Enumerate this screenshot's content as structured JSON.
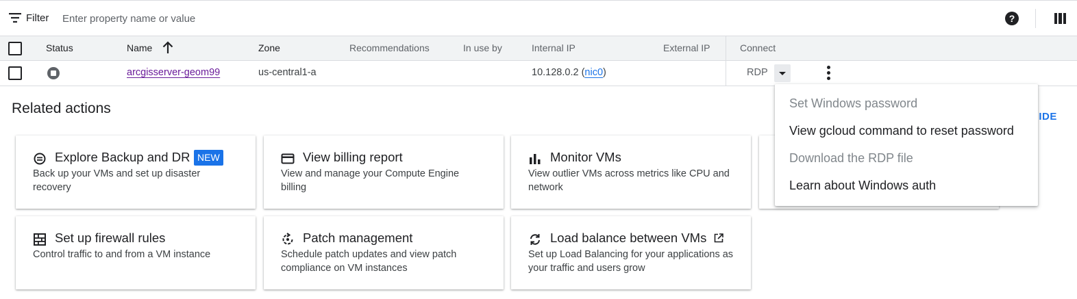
{
  "filter": {
    "label": "Filter",
    "placeholder": "Enter property name or value",
    "value": ""
  },
  "table": {
    "headers": {
      "status": "Status",
      "name": "Name",
      "zone": "Zone",
      "recommendations": "Recommendations",
      "in_use_by": "In use by",
      "internal_ip": "Internal IP",
      "external_ip": "External IP",
      "connect": "Connect"
    },
    "rows": [
      {
        "name": "arcgisserver-geom99",
        "zone": "us-central1-a",
        "internal_ip": "10.128.0.2 (",
        "nic": "nic0",
        "ip_close": ")",
        "connect": "RDP"
      }
    ]
  },
  "related": {
    "title": "Related actions",
    "hide_label": "HIDE",
    "cards": [
      {
        "title": "Explore Backup and DR",
        "badge": "NEW",
        "desc": "Back up your VMs and set up disaster recovery",
        "icon": "backup-icon"
      },
      {
        "title": "View billing report",
        "desc": "View and manage your Compute Engine billing",
        "icon": "billing-card-icon"
      },
      {
        "title": "Monitor VMs",
        "desc": "View outlier VMs across metrics like CPU and network",
        "icon": "bar-chart-icon"
      },
      {
        "title": "Set up firewall rules",
        "desc": "Control traffic to and from a VM instance",
        "icon": "firewall-icon"
      },
      {
        "title": "Patch management",
        "desc": "Schedule patch updates and view patch compliance on VM instances",
        "icon": "patch-icon"
      },
      {
        "title": "Load balance between VMs",
        "desc": "Set up Load Balancing for your applications as your traffic and users grow",
        "icon": "load-balance-icon"
      }
    ]
  },
  "menu": {
    "items": [
      {
        "label": "Set Windows password",
        "disabled": true
      },
      {
        "label": "View gcloud command to reset password",
        "disabled": false
      },
      {
        "label": "Download the RDP file",
        "disabled": true
      },
      {
        "label": "Learn about Windows auth",
        "disabled": false
      }
    ]
  },
  "colors": {
    "accent": "#1a73e8",
    "link_visited": "#6a1b9a",
    "header_bg": "#f1f3f4",
    "disabled_text": "#80868b"
  }
}
